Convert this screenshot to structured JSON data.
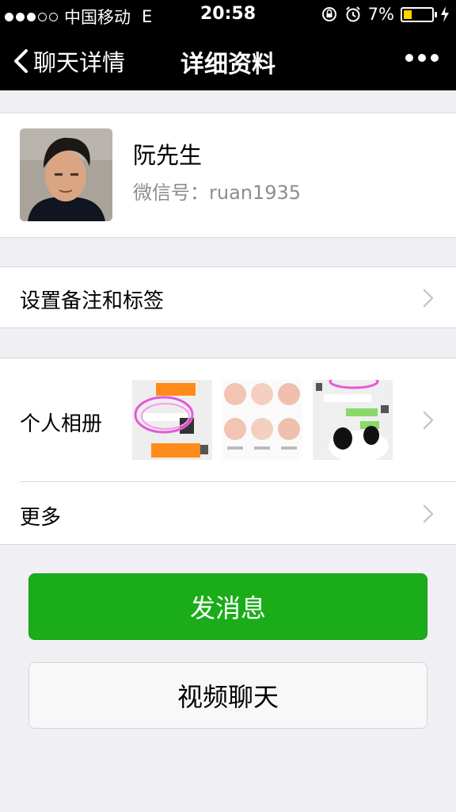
{
  "status_bar": {
    "carrier": "中国移动",
    "network": "E",
    "time": "20:58",
    "battery": "7%",
    "battery_level": 0.07
  },
  "nav": {
    "back_label": "聊天详情",
    "title": "详细资料",
    "more_icon": "more-dots-icon"
  },
  "profile": {
    "name": "阮先生",
    "wechat_id_label": "微信号：",
    "wechat_id": "ruan1935"
  },
  "rows": {
    "remark_label": "设置备注和标签",
    "album_label": "个人相册",
    "more_label": "更多"
  },
  "buttons": {
    "send_message": "发消息",
    "video_chat": "视频聊天"
  },
  "colors": {
    "primary_green": "#1aad19",
    "nav_background": "#000000",
    "page_background": "#efeff4",
    "secondary_text": "#8d8d8d"
  }
}
